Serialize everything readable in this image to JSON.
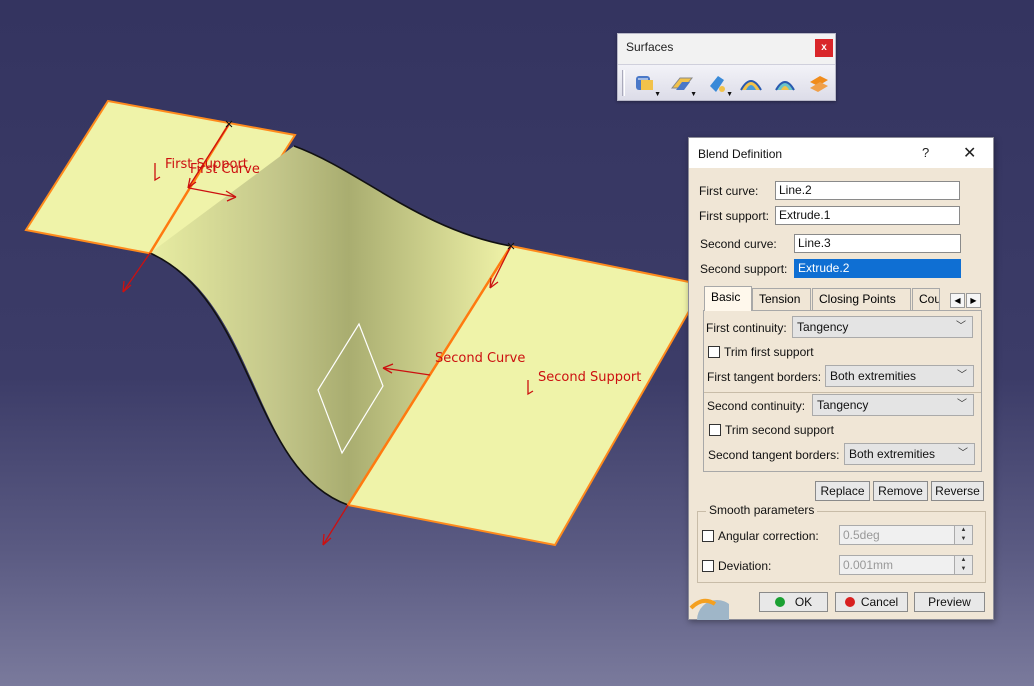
{
  "viewport": {
    "labels": {
      "first_support": "First Support",
      "first_curve": "First Curve",
      "second_curve": "Second Curve",
      "second_support": "Second Support"
    }
  },
  "toolbar": {
    "title": "Surfaces",
    "close": "x",
    "icons": [
      "blend-group-icon",
      "fill-group-icon",
      "multi-section-group-icon",
      "sweep-icon",
      "offset-icon",
      "extrapolate-icon"
    ]
  },
  "dialog": {
    "title": "Blend Definition",
    "help": "?",
    "close": "✕",
    "first_curve_label": "First curve:",
    "first_curve_value": "Line.2",
    "first_support_label": "First support:",
    "first_support_value": "Extrude.1",
    "second_curve_label": "Second curve:",
    "second_curve_value": "Line.3",
    "second_support_label": "Second support:",
    "second_support_value": "Extrude.2",
    "tabs": [
      "Basic",
      "Tension",
      "Closing Points",
      "Cou"
    ],
    "first_continuity_label": "First continuity:",
    "first_continuity_value": "Tangency",
    "trim_first_label": "Trim first support",
    "first_tangent_borders_label": "First tangent borders:",
    "first_tangent_borders_value": "Both extremities",
    "second_continuity_label": "Second continuity:",
    "second_continuity_value": "Tangency",
    "trim_second_label": "Trim second support",
    "second_tangent_borders_label": "Second tangent borders:",
    "second_tangent_borders_value": "Both extremities",
    "replace_label": "Replace",
    "remove_label": "Remove",
    "reverse_label": "Reverse",
    "smooth_title": "Smooth parameters",
    "angular_label": "Angular correction:",
    "angular_value": "0.5deg",
    "deviation_label": "Deviation:",
    "deviation_value": "0.001mm",
    "ok_label": "OK",
    "cancel_label": "Cancel",
    "preview_label": "Preview"
  },
  "colors": {
    "background_top": "#343460",
    "surface_fill": "#eff3a9",
    "edge_orange": "#ff8a1c",
    "label_red": "#cc1010",
    "selection_blue": "#0f6fd3"
  }
}
